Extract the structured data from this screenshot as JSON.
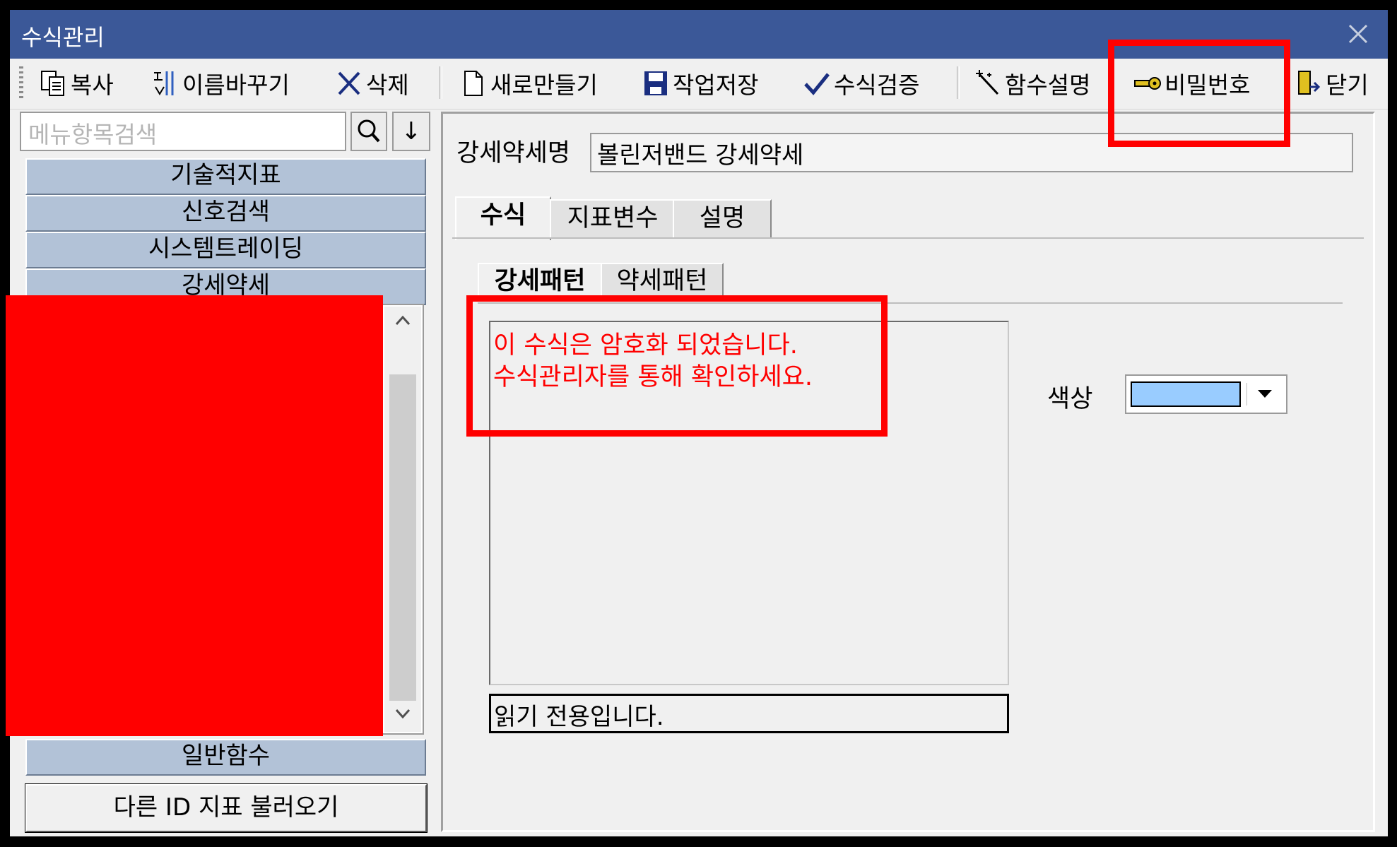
{
  "window": {
    "title": "수식관리"
  },
  "toolbar": {
    "items": [
      {
        "label": "복사",
        "icon": "copy-icon"
      },
      {
        "label": "이름바꾸기",
        "icon": "rename-icon"
      },
      {
        "label": "삭제",
        "icon": "delete-x-icon"
      },
      {
        "label": "새로만들기",
        "icon": "new-document-icon"
      },
      {
        "label": "작업저장",
        "icon": "floppy-save-icon"
      },
      {
        "label": "수식검증",
        "icon": "checkmark-icon"
      },
      {
        "label": "함수설명",
        "icon": "magic-wand-icon"
      },
      {
        "label": "비밀번호",
        "icon": "key-icon"
      },
      {
        "label": "닫기",
        "icon": "exit-door-icon"
      }
    ]
  },
  "sidebar": {
    "search_placeholder": "메뉴항목검색",
    "down_label": "↓",
    "categories": [
      "기술적지표",
      "신호검색",
      "시스템트레이딩",
      "강세약세",
      "일반함수"
    ],
    "load_button": "다른 ID 지표 불러오기",
    "scroll_up": "^",
    "scroll_down": "v"
  },
  "main": {
    "name_label": "강세약세명",
    "name_value": "볼린저밴드 강세약세",
    "tabs": [
      "수식",
      "지표변수",
      "설명"
    ],
    "active_tab": "수식",
    "subtabs": [
      "강세패턴",
      "약세패턴"
    ],
    "active_subtab": "강세패턴",
    "formula_message": [
      "이 수식은 암호화 되었습니다.",
      "수식관리자를 통해 확인하세요."
    ],
    "status_text": "읽기 전용입니다.",
    "color_label": "색상",
    "color_value": "#99ccff"
  },
  "colors": {
    "titlebar": "#3b5898",
    "category_bg": "#b2c2d7",
    "annotation_red": "#ff0000",
    "message_red": "#ff0000"
  }
}
